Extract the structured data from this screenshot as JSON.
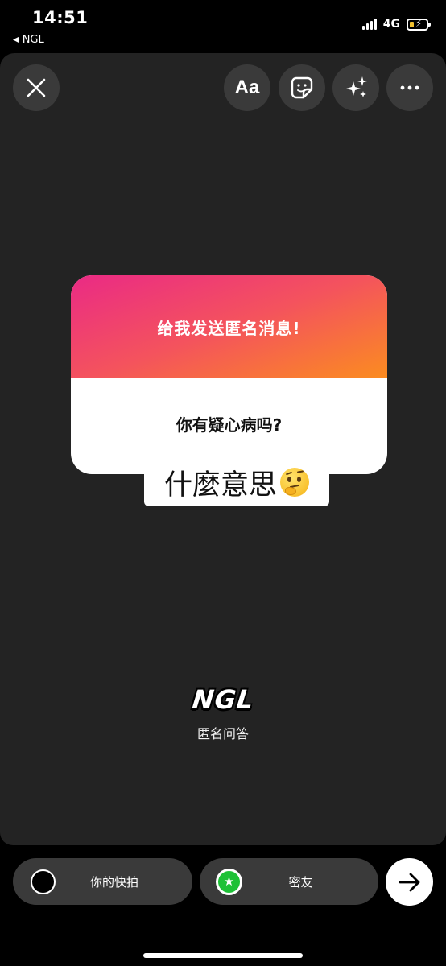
{
  "status_bar": {
    "time": "14:51",
    "back_app": "NGL",
    "network": "4G",
    "battery_color": "#f2c230"
  },
  "toolbar": {
    "close_icon": "close-icon",
    "text_label": "Aa",
    "sticker_icon": "sticker-icon",
    "effects_icon": "sparkles-icon",
    "more_icon": "more-icon"
  },
  "card": {
    "title": "给我发送匿名消息!",
    "question": "你有疑心病吗?",
    "gradient": [
      "#ea2a85",
      "#f4535d",
      "#fb8c20"
    ]
  },
  "reply": {
    "text": "什麼意思",
    "emoji": "thinking-face"
  },
  "brand": {
    "logo": "NGL",
    "subtitle": "匿名问答"
  },
  "share": {
    "story_label": "你的快拍",
    "close_friends_label": "密友",
    "close_friends_color": "#1ec137",
    "next_icon": "arrow-right-icon"
  }
}
